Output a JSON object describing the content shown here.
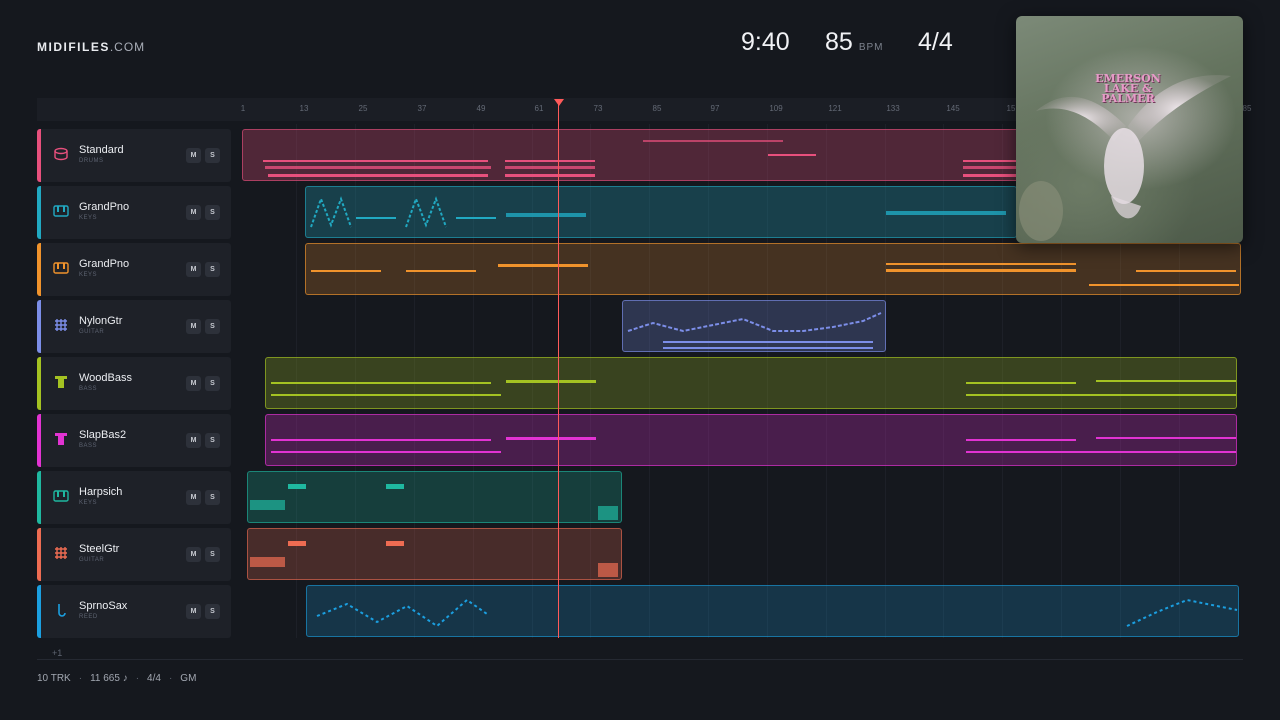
{
  "header": {
    "brand": "MIDIFILES",
    "brand_domain": ".COM",
    "time": "9:40",
    "bpm": "85",
    "bpm_unit": "BPM",
    "time_signature": "4/4"
  },
  "album": {
    "title_line1": "EMERSON",
    "title_line2": "LAKE & ",
    "title_line3": "PALMER"
  },
  "ruler": {
    "ticks": [
      "1",
      "13",
      "25",
      "37",
      "49",
      "61",
      "73",
      "85",
      "97",
      "109",
      "121",
      "133",
      "145",
      "15",
      "85"
    ]
  },
  "tracks": [
    {
      "name": "Standard",
      "category": "DRUMS",
      "color": "#e8507d",
      "icon": "drum-icon",
      "mute": "M",
      "solo": "S"
    },
    {
      "name": "GrandPno",
      "category": "KEYS",
      "color": "#21a9c2",
      "icon": "piano-icon",
      "mute": "M",
      "solo": "S"
    },
    {
      "name": "GrandPno",
      "category": "KEYS",
      "color": "#f0932c",
      "icon": "piano-icon",
      "mute": "M",
      "solo": "S"
    },
    {
      "name": "NylonGtr",
      "category": "GUITAR",
      "color": "#7c8ee8",
      "icon": "guitar-icon",
      "mute": "M",
      "solo": "S"
    },
    {
      "name": "WoodBass",
      "category": "BASS",
      "color": "#a4c222",
      "icon": "bass-icon",
      "mute": "M",
      "solo": "S"
    },
    {
      "name": "SlapBas2",
      "category": "BASS",
      "color": "#e233d2",
      "icon": "bass-icon",
      "mute": "M",
      "solo": "S"
    },
    {
      "name": "Harpsich",
      "category": "KEYS",
      "color": "#1fb8a0",
      "icon": "piano-icon",
      "mute": "M",
      "solo": "S"
    },
    {
      "name": "SteelGtr",
      "category": "GUITAR",
      "color": "#ee6c52",
      "icon": "guitar-icon",
      "mute": "M",
      "solo": "S"
    },
    {
      "name": "SprnoSax",
      "category": "REED",
      "color": "#1b9fe0",
      "icon": "sax-icon",
      "mute": "M",
      "solo": "S"
    }
  ],
  "more_tracks": "+1",
  "footer": {
    "tracks": "10 TRK",
    "notes": "11 665 ♪",
    "signature": "4/4",
    "standard": "GM"
  }
}
